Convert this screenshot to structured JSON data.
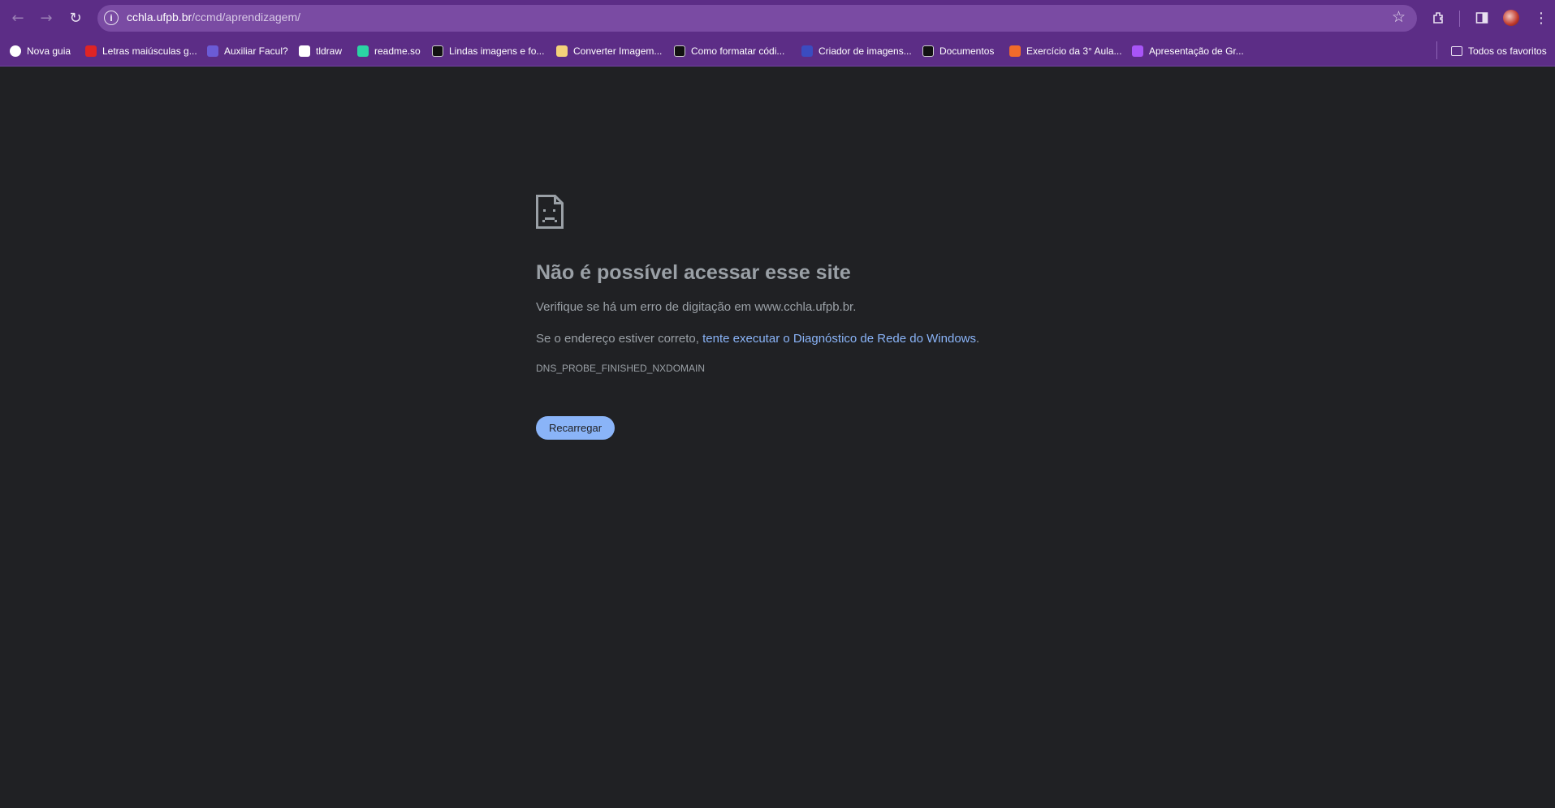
{
  "browser": {
    "url_host": "cchla.ufpb.br",
    "url_path": "/ccmd/aprendizagem/",
    "icons": [
      "back-icon",
      "forward-icon",
      "reload-icon",
      "site-info-icon",
      "bookmark-star-icon",
      "extensions-icon",
      "side-panel-icon",
      "profile-avatar",
      "menu-icon"
    ]
  },
  "bookmarks": {
    "items": [
      {
        "label": "Nova guia",
        "color": "#ffffff"
      },
      {
        "label": "Letras maiúsculas g...",
        "color": "#e02424"
      },
      {
        "label": "Auxiliar Facul?",
        "color": "#6b5bd6"
      },
      {
        "label": "tldraw",
        "color": "#ffffff"
      },
      {
        "label": "readme.so",
        "color": "#2bd4a4"
      },
      {
        "label": "Lindas imagens e fo...",
        "color": "#111111"
      },
      {
        "label": "Converter Imagem...",
        "color": "#f4d27a"
      },
      {
        "label": "Como formatar códi...",
        "color": "#111111"
      },
      {
        "label": "Criador de imagens...",
        "color": "#3b4cc0"
      },
      {
        "label": "Documentos",
        "color": "#111111"
      },
      {
        "label": "Exercício da 3° Aula...",
        "color": "#f26b2a"
      },
      {
        "label": "Apresentação de Gr...",
        "color": "#a855f7"
      }
    ],
    "all_favorites": "Todos os favoritos"
  },
  "error": {
    "title": "Não é possível acessar esse site",
    "line1": "Verifique se há um erro de digitação em www.cchla.ufpb.br.",
    "line2_prefix": "Se o endereço estiver correto,",
    "line2_link": "tente executar o Diagnóstico de Rede do Windows",
    "line2_suffix": ".",
    "code": "DNS_PROBE_FINISHED_NXDOMAIN",
    "reload_button": "Recarregar"
  },
  "colors": {
    "chrome_bg": "#5c2d86",
    "omnibox_bg": "#7a4ba3",
    "page_bg": "#202124",
    "text": "#9aa0a6",
    "link": "#8ab4f8"
  }
}
